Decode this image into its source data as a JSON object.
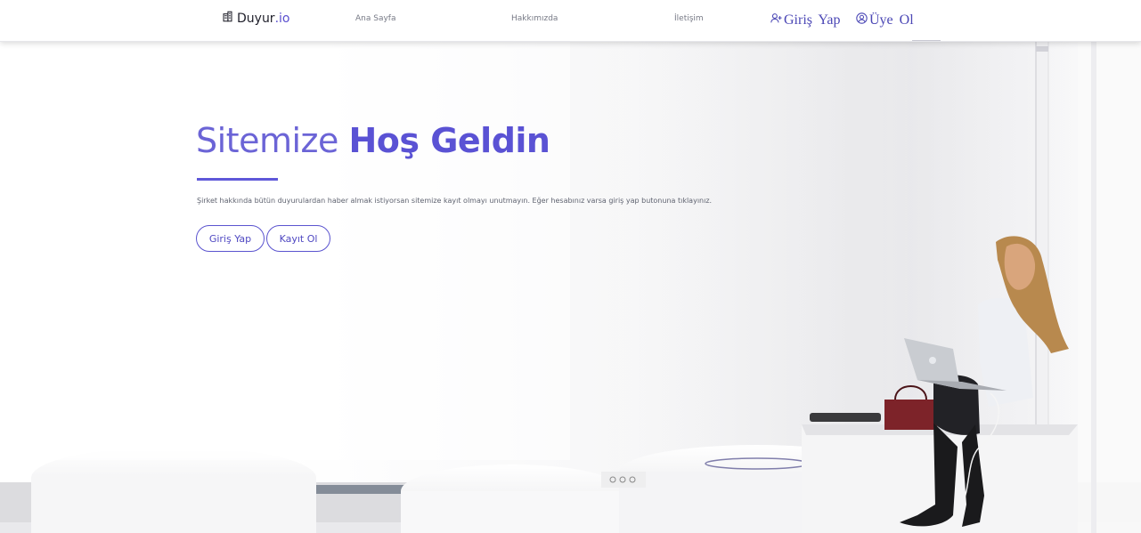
{
  "navbar": {
    "brand_name": "Duyur",
    "brand_tld": ".io",
    "links": [
      "Ana Sayfa",
      "Hakkımızda",
      "İletişim"
    ],
    "login_label": "Giriş Yap",
    "register_label": "Üye Ol"
  },
  "hero": {
    "title_light": "Sitemize",
    "title_strong": "Hoş Geldin",
    "description": "Şirket hakkında bütün duyurulardan haber almak istiyorsan sitemize kayıt olmayı unutmayın. Eğer hesabınız varsa giriş yap butonuna tıklayınız.",
    "login_button": "Giriş Yap",
    "register_button": "Kayıt Ol"
  },
  "colors": {
    "accent": "#5a52d4",
    "text_muted": "#777a86"
  },
  "icons": {
    "brand": "building-icon",
    "login": "user-plus-icon",
    "register": "user-circle-icon"
  }
}
